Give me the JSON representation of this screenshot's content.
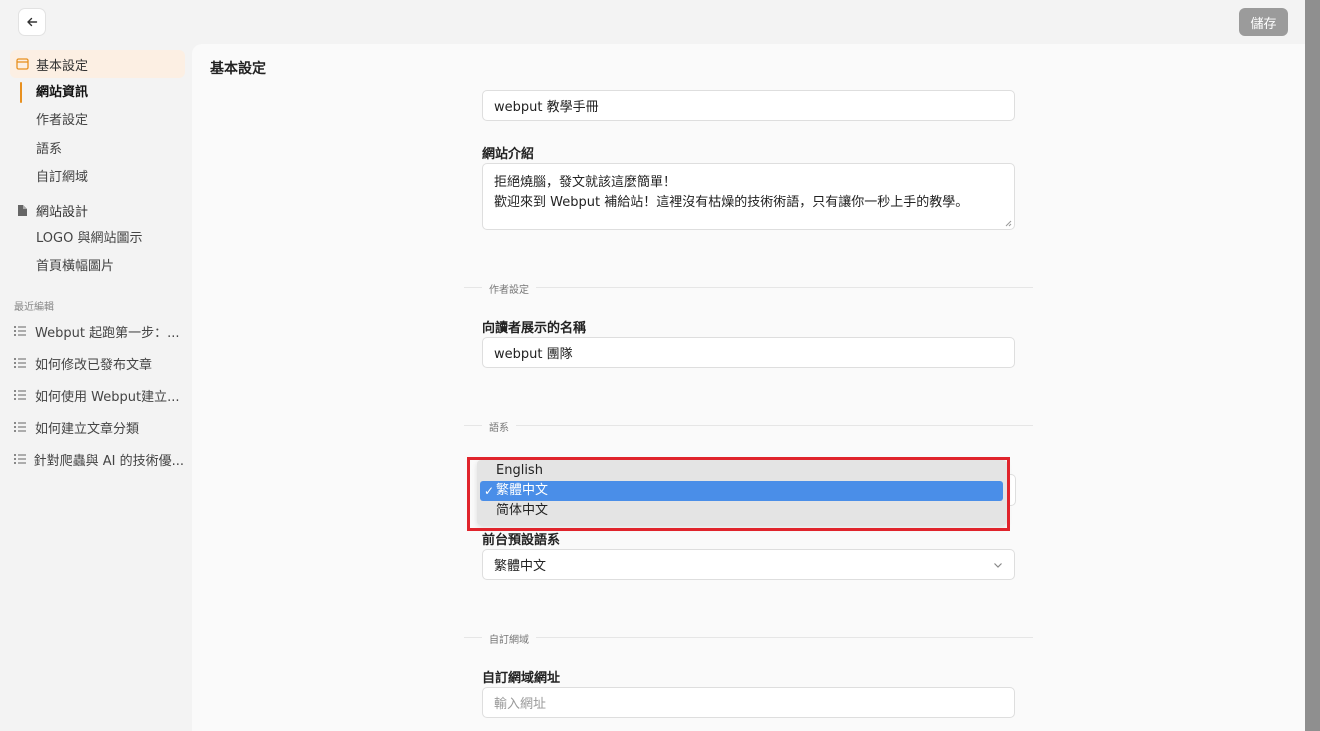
{
  "header": {
    "save_label": "儲存"
  },
  "sidebar": {
    "sections": [
      {
        "label": "基本設定",
        "icon": "window-icon",
        "items": [
          "網站資訊",
          "作者設定",
          "語系",
          "自訂網域"
        ],
        "active_item": "網站資訊"
      },
      {
        "label": "網站設計",
        "icon": "palette-icon",
        "items": [
          "LOGO 與網站圖示",
          "首頁橫幅圖片"
        ]
      }
    ],
    "recent_label": "最近編輯",
    "recent": [
      "Webput 起跑第一步：...",
      "如何修改已發布文章",
      "如何使用 Webput建立...",
      "如何建立文章分類",
      "針對爬蟲與 AI 的技術優..."
    ]
  },
  "main": {
    "title": "基本設定",
    "site_name_value": "webput 教學手冊",
    "site_intro_label": "網站介紹",
    "site_intro_lines": [
      "拒絕燒腦，發文就該這麼簡單！",
      "歡迎來到 Webput 補給站！這裡沒有枯燥的技術術語，只有讓你一秒上手的教學。"
    ],
    "author_section": "作者設定",
    "author_name_label": "向讀者展示的名稱",
    "author_name_value": "webput 團隊",
    "language_section": "語系",
    "language_dropdown": {
      "options": [
        "English",
        "繁體中文",
        "简体中文"
      ],
      "selected": "繁體中文"
    },
    "frontend_lang_label": "前台預設語系",
    "frontend_lang_value": "繁體中文",
    "domain_section": "自訂網域",
    "domain_url_label": "自訂網域網址",
    "domain_url_placeholder": "輸入網址"
  },
  "colors": {
    "accent": "#e8901f",
    "highlight": "#e0242c",
    "selection": "#4a8ee8"
  }
}
